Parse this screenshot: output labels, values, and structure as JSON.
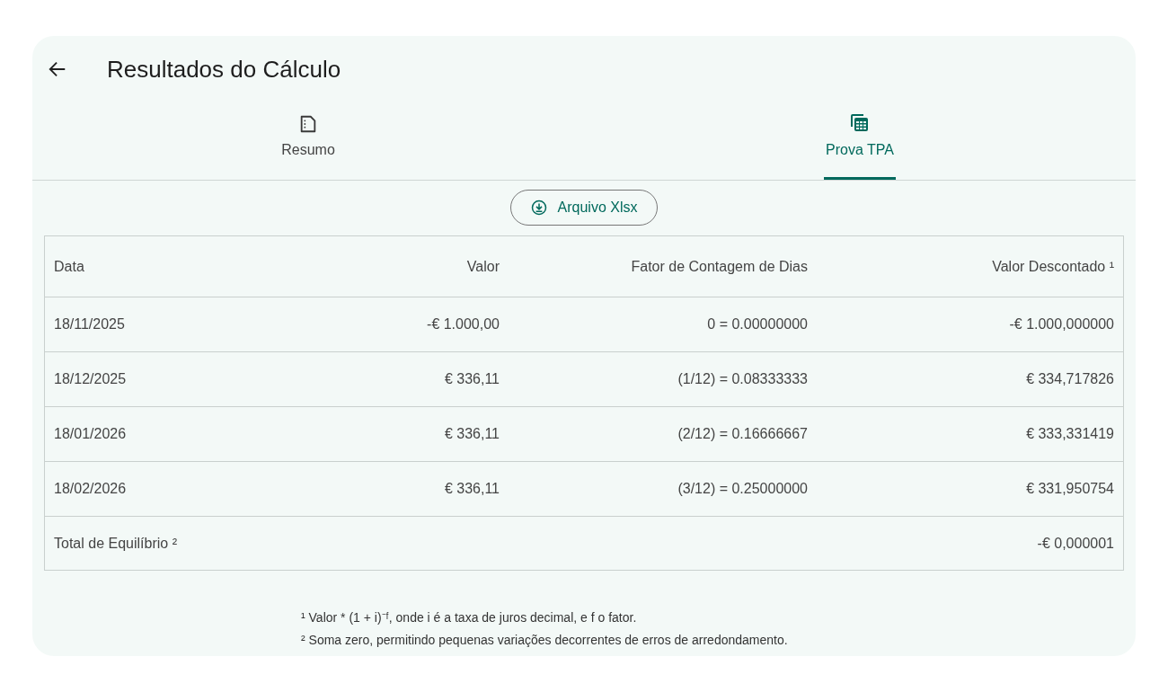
{
  "title": "Resultados do Cálculo",
  "tabs": [
    {
      "label": "Resumo",
      "kind": "document",
      "selected": false
    },
    {
      "label": "Prova TPA",
      "kind": "calculator",
      "selected": true
    }
  ],
  "download_button": "Arquivo Xlsx",
  "table": {
    "columns": [
      "Data",
      "Valor",
      "Fator de Contagem de Dias",
      "Valor Descontado ¹"
    ],
    "rows": [
      [
        "18/11/2025",
        "-€ 1.000,00",
        "0 = 0.00000000",
        "-€ 1.000,000000"
      ],
      [
        "18/12/2025",
        "€ 336,11",
        "(1/12) = 0.08333333",
        "€ 334,717826"
      ],
      [
        "18/01/2026",
        "€ 336,11",
        "(2/12) = 0.16666667",
        "€ 333,331419"
      ],
      [
        "18/02/2026",
        "€ 336,11",
        "(3/12) = 0.25000000",
        "€ 331,950754"
      ]
    ],
    "total": {
      "label": "Total de Equilíbrio ²",
      "value": "-€ 0,000001"
    }
  },
  "footnotes": [
    "¹ Valor * (1 + i)⁻ᶠ, onde i é a taxa de juros decimal, e f o fator.",
    "² Soma zero, permitindo pequenas variações decorrentes de erros de arredondamento."
  ]
}
